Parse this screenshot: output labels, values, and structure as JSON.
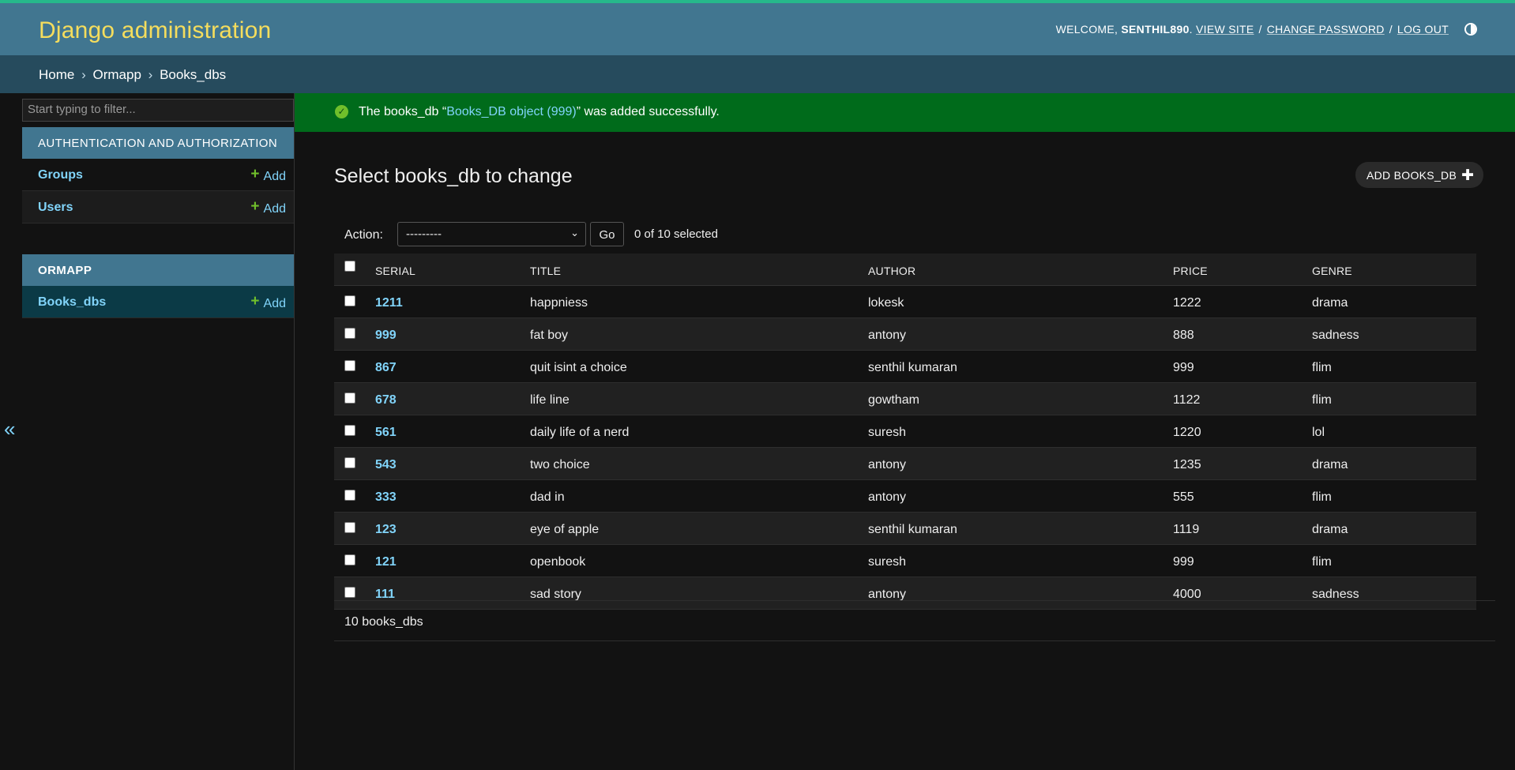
{
  "header": {
    "site_name": "Django administration",
    "welcome": "WELCOME,",
    "username": "SENTHIL890",
    "view_site": "VIEW SITE",
    "change_password": "CHANGE PASSWORD",
    "log_out": "LOG OUT",
    "sep": "/",
    "theme_icon": "contrast-half-circle-icon"
  },
  "breadcrumbs": {
    "items": [
      "Home",
      "Ormapp",
      "Books_dbs"
    ],
    "separator": "›"
  },
  "sidebar": {
    "toggle": "«",
    "filter_placeholder": "Start typing to filter...",
    "apps": [
      {
        "caption": "AUTHENTICATION AND AUTHORIZATION",
        "models": [
          {
            "name": "Groups",
            "add": "Add"
          },
          {
            "name": "Users",
            "add": "Add"
          }
        ]
      },
      {
        "caption": "ORMAPP",
        "models": [
          {
            "name": "Books_dbs",
            "add": "Add"
          }
        ]
      }
    ]
  },
  "message": {
    "prefix": "The books_db “",
    "link": "Books_DB object (999)",
    "suffix": "” was added successfully."
  },
  "main": {
    "title": "Select books_db to change",
    "add_button": "ADD BOOKS_DB",
    "action_label": "Action:",
    "action_select_value": "---------",
    "go_button": "Go",
    "selection_counter": "0 of 10 selected",
    "paginator": "10 books_dbs"
  },
  "table": {
    "columns": [
      "SERIAL",
      "TITLE",
      "AUTHOR",
      "PRICE",
      "GENRE"
    ],
    "rows": [
      {
        "serial": "1211",
        "title": "happniess",
        "author": "lokesk",
        "price": "1222",
        "genre": "drama"
      },
      {
        "serial": "999",
        "title": "fat boy",
        "author": "antony",
        "price": "888",
        "genre": "sadness"
      },
      {
        "serial": "867",
        "title": "quit isint a choice",
        "author": "senthil kumaran",
        "price": "999",
        "genre": "flim"
      },
      {
        "serial": "678",
        "title": "life line",
        "author": "gowtham",
        "price": "1122",
        "genre": "flim"
      },
      {
        "serial": "561",
        "title": "daily life of a nerd",
        "author": "suresh",
        "price": "1220",
        "genre": "lol"
      },
      {
        "serial": "543",
        "title": "two choice",
        "author": "antony",
        "price": "1235",
        "genre": "drama"
      },
      {
        "serial": "333",
        "title": "dad in",
        "author": "antony",
        "price": "555",
        "genre": "flim"
      },
      {
        "serial": "123",
        "title": "eye of apple",
        "author": "senthil kumaran",
        "price": "1119",
        "genre": "drama"
      },
      {
        "serial": "121",
        "title": "openbook",
        "author": "suresh",
        "price": "999",
        "genre": "flim"
      },
      {
        "serial": "111",
        "title": "sad story",
        "author": "antony",
        "price": "4000",
        "genre": "sadness"
      }
    ]
  },
  "colors": {
    "header_bg": "#417690",
    "breadcrumb_bg": "#264b5d",
    "brand_text": "#f5dd5d",
    "link": "#81d4fa",
    "success_bg": "#006b1b",
    "add_icon": "#70bf2b"
  }
}
